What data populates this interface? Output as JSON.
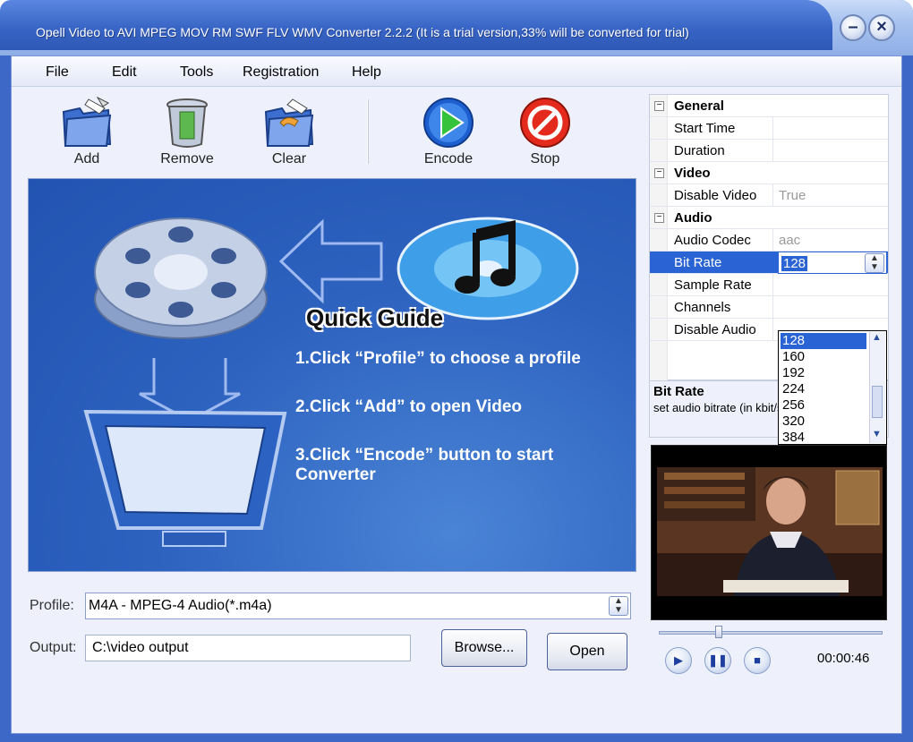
{
  "window": {
    "title": "Opell Video to AVI MPEG MOV RM SWF FLV WMV Converter 2.2.2 (It is a trial version,33% will be converted for trial)",
    "minimize_label": "–",
    "close_label": "×"
  },
  "menu": {
    "file": "File",
    "edit": "Edit",
    "tools": "Tools",
    "registration": "Registration",
    "help": "Help"
  },
  "toolbar": {
    "add": "Add",
    "remove": "Remove",
    "clear": "Clear",
    "encode": "Encode",
    "stop": "Stop"
  },
  "guide": {
    "title": "Quick Guide",
    "steps": [
      "1.Click “Profile” to choose a profile",
      "2.Click “Add”  to open Video",
      "3.Click “Encode” button to start Converter"
    ]
  },
  "profile": {
    "label": "Profile:",
    "value": "M4A - MPEG-4 Audio(*.m4a)"
  },
  "output": {
    "label": "Output:",
    "value": "C:\\video output",
    "browse_label": "Browse...",
    "open_label": "Open"
  },
  "properties": {
    "general": {
      "title": "General",
      "start_time": {
        "key": "Start Time",
        "value": ""
      },
      "duration": {
        "key": "Duration",
        "value": ""
      }
    },
    "video": {
      "title": "Video",
      "disable_video": {
        "key": "Disable Video",
        "value": "True"
      }
    },
    "audio": {
      "title": "Audio",
      "audio_codec": {
        "key": "Audio Codec",
        "value": "aac"
      },
      "bit_rate": {
        "key": "Bit Rate",
        "value": "128"
      },
      "sample_rate": {
        "key": "Sample Rate",
        "value": ""
      },
      "channels": {
        "key": "Channels",
        "value": ""
      },
      "disable_audio": {
        "key": "Disable Audio",
        "value": ""
      }
    },
    "bitrate_options": [
      "128",
      "160",
      "192",
      "224",
      "256",
      "320",
      "384"
    ],
    "description": {
      "title": "Bit Rate",
      "text": "set audio bitrate (in kbit/s)"
    }
  },
  "player": {
    "timecode": "00:00:46"
  },
  "colors": {
    "title_bar": "#3663c4",
    "selection": "#2a63d4",
    "guide_bg": "#2d62bf"
  }
}
